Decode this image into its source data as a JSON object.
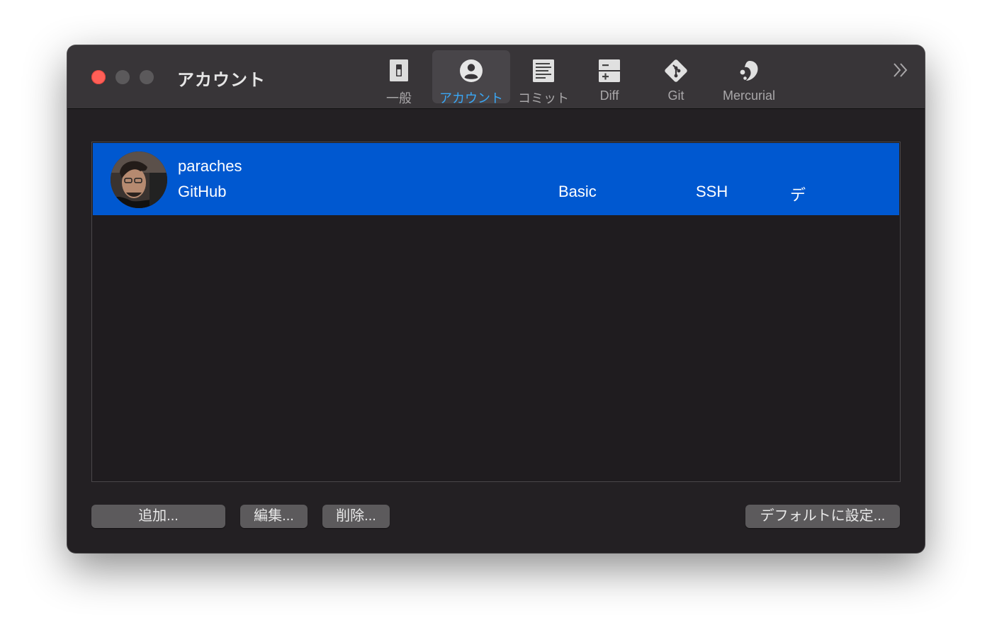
{
  "window": {
    "title": "アカウント"
  },
  "toolbar": {
    "items": [
      {
        "label": "一般",
        "icon": "general-switch-icon"
      },
      {
        "label": "アカウント",
        "icon": "account-person-icon",
        "selected": true
      },
      {
        "label": "コミット",
        "icon": "commit-document-icon"
      },
      {
        "label": "Diff",
        "icon": "diff-icon"
      },
      {
        "label": "Git",
        "icon": "git-icon"
      },
      {
        "label": "Mercurial",
        "icon": "mercurial-icon"
      }
    ],
    "overflow_label": "»"
  },
  "accounts": [
    {
      "name": "paraches",
      "service": "GitHub",
      "auth": "Basic",
      "protocol": "SSH",
      "default": "デ",
      "selected": true
    }
  ],
  "buttons": {
    "add": "追加...",
    "edit": "編集...",
    "delete": "削除...",
    "set_default": "デフォルトに設定..."
  },
  "colors": {
    "selection": "#0058d0",
    "close": "#ff5f57",
    "accent": "#3aa7f5"
  }
}
